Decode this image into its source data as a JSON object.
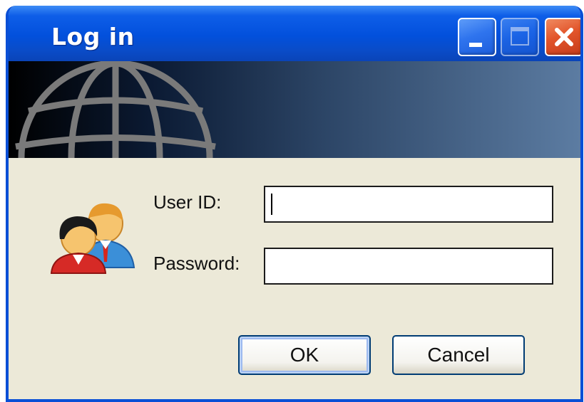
{
  "window": {
    "title": "Log in",
    "controls": {
      "minimize": "minimize-icon",
      "maximize": "maximize-icon",
      "close": "close-icon"
    }
  },
  "banner": {
    "icon": "globe-icon"
  },
  "form": {
    "avatar_icon": "users-icon",
    "user_id_label": "User ID:",
    "user_id_value": "",
    "password_label": "Password:",
    "password_value": ""
  },
  "buttons": {
    "ok_label": "OK",
    "cancel_label": "Cancel"
  },
  "colors": {
    "titlebar": "#0250dc",
    "close": "#e2552b",
    "dialog_bg": "#ece9d8"
  }
}
